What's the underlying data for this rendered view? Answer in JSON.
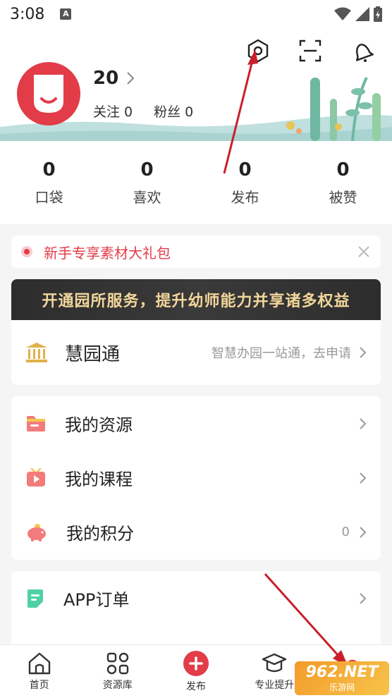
{
  "status_bar": {
    "time": "3:08",
    "badge": "A"
  },
  "profile": {
    "name": "20",
    "follow_label": "关注 0",
    "fans_label": "粉丝 0"
  },
  "stats": [
    {
      "value": "0",
      "label": "口袋"
    },
    {
      "value": "0",
      "label": "喜欢"
    },
    {
      "value": "0",
      "label": "发布"
    },
    {
      "value": "0",
      "label": "被赞"
    }
  ],
  "promo": {
    "text": "新手专享素材大礼包"
  },
  "banner": {
    "text": "开通园所服务，提升幼师能力并享诸多权益"
  },
  "huiyuantong": {
    "title": "慧园通",
    "subtitle": "智慧办园一站通，去申请"
  },
  "menu": [
    {
      "label": "我的资源",
      "icon": "folder-icon",
      "value": ""
    },
    {
      "label": "我的课程",
      "icon": "video-icon",
      "value": ""
    },
    {
      "label": "我的积分",
      "icon": "piggy-bank-icon",
      "value": "0"
    }
  ],
  "menu2": [
    {
      "label": "APP订单",
      "icon": "order-icon"
    }
  ],
  "bottom_nav": [
    {
      "label": "首页",
      "icon": "home-icon"
    },
    {
      "label": "资源库",
      "icon": "grid-icon"
    },
    {
      "label": "发布",
      "icon": "plus-icon"
    },
    {
      "label": "专业提升",
      "icon": "graduation-cap-icon"
    },
    {
      "label": "",
      "icon": "profile-icon"
    }
  ],
  "watermark": {
    "main": "962.NET",
    "sub": "乐游网"
  },
  "colors": {
    "accent": "#e23c48",
    "banner_text": "#f2d69a",
    "arrow": "#c8202a"
  }
}
